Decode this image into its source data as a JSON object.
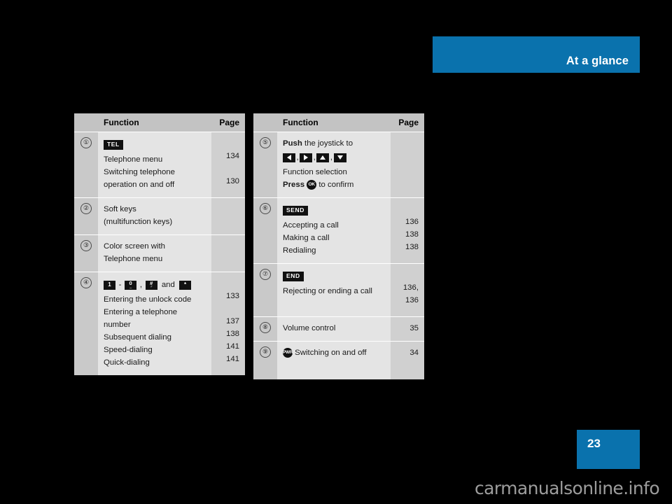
{
  "header": {
    "title": "At a glance",
    "banner_color": "#0a72ad"
  },
  "page_tab": {
    "number": "23",
    "color": "#0a72ad"
  },
  "watermark": {
    "text": "carmanualsonline.info"
  },
  "tables": {
    "left": {
      "headers": {
        "num": "",
        "function": "Function",
        "page": "Page"
      },
      "rows": [
        {
          "number": "①",
          "badge": "TEL",
          "lines": [
            {
              "text": "Telephone menu",
              "page": "134"
            },
            {
              "text": "Switching telephone",
              "page": ""
            },
            {
              "text": "operation on and off",
              "page": "130"
            }
          ]
        },
        {
          "number": "②",
          "lines": [
            {
              "text": "Soft keys",
              "page": ""
            },
            {
              "text": "(multifunction keys)",
              "page": ""
            }
          ]
        },
        {
          "number": "③",
          "lines": [
            {
              "text": "Color screen with",
              "page": ""
            },
            {
              "text": "Telephone menu",
              "page": ""
            }
          ]
        },
        {
          "number": "④",
          "keys": {
            "key_1_main": "1",
            "key_1_sub": "",
            "dash": "-",
            "key_0_main": "0",
            "key_0_sub": "_",
            "comma": ",",
            "key_hash_main": "#",
            "key_hash_sub": "♂",
            "and": "and",
            "key_star_main": "*",
            "key_star_sub": ""
          },
          "lines": [
            {
              "text": "Entering the unlock code",
              "page": "133"
            },
            {
              "text": "Entering a telephone",
              "page": ""
            },
            {
              "text": "number",
              "page": "137"
            },
            {
              "text": "Subsequent dialing",
              "page": "138"
            },
            {
              "text": "Speed-dialing",
              "page": "141"
            },
            {
              "text": "Quick-dialing",
              "page": "141"
            }
          ]
        }
      ]
    },
    "right": {
      "headers": {
        "num": "",
        "function": "Function",
        "page": "Page"
      },
      "rows": [
        {
          "number": "⑤",
          "push_bold": "Push",
          "push_rest": " the joystick to",
          "arrows": [
            "arrow-left",
            "arrow-right",
            "arrow-up",
            "arrow-down"
          ],
          "function_selection": "Function selection",
          "press_bold": "Press",
          "press_badge": "OK",
          "press_rest": " to confirm",
          "lines": []
        },
        {
          "number": "⑥",
          "badge": "SEND",
          "lines": [
            {
              "text": "Accepting a call",
              "page": "136"
            },
            {
              "text": "Making a call",
              "page": "138"
            },
            {
              "text": "Redialing",
              "page": "138"
            }
          ]
        },
        {
          "number": "⑦",
          "badge": "END",
          "lines": [
            {
              "text": "Rejecting or ending a call",
              "page": "136,"
            },
            {
              "text": "",
              "page": "136"
            }
          ]
        },
        {
          "number": "⑧",
          "lines": [
            {
              "text": "Volume control",
              "page": "35"
            }
          ]
        },
        {
          "number": "⑨",
          "pwr_badge": "PWR",
          "lines": [
            {
              "text": "Switching on and off",
              "page": "34"
            }
          ]
        }
      ]
    }
  }
}
